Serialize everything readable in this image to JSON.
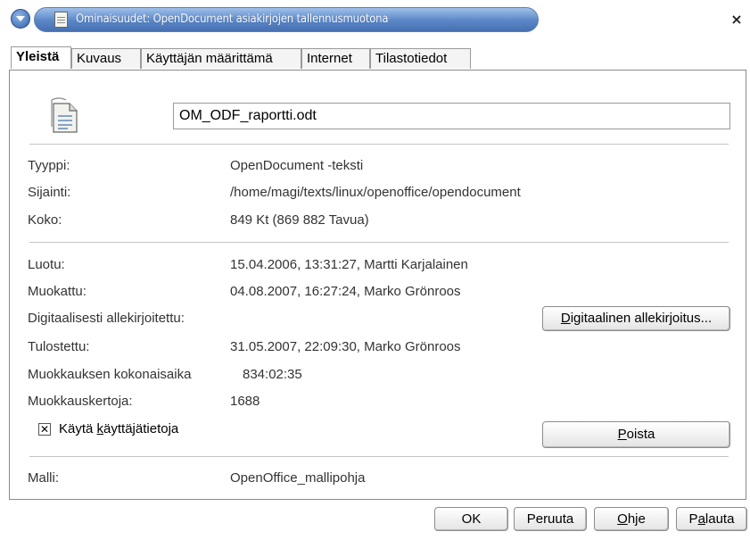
{
  "window": {
    "title": "Ominaisuudet: OpenDocument asiakirjojen tallennusmuotona",
    "close_glyph": "×"
  },
  "tabs": [
    {
      "label": "Yleistä",
      "active": true
    },
    {
      "label": "Kuvaus",
      "active": false
    },
    {
      "label": "Käyttäjän määrittämä",
      "active": false
    },
    {
      "label": "Internet",
      "active": false
    },
    {
      "label": "Tilastotiedot",
      "active": false
    }
  ],
  "general": {
    "file_icon": "document-icon",
    "file_name": "OM_ODF_raportti.odt",
    "type_label": "Tyyppi:",
    "type_value": "OpenDocument -teksti",
    "location_label": "Sijainti:",
    "location_value": "/home/magi/texts/linux/openoffice/opendocument",
    "size_label": "Koko:",
    "size_value": "849 Kt (869 882 Tavua)",
    "created_label": "Luotu:",
    "created_value": "15.04.2006, 13:31:27, Martti Karjalainen",
    "modified_label": "Muokattu:",
    "modified_value": "04.08.2007, 16:27:24, Marko Grönroos",
    "signed_label": "Digitaalisesti allekirjoitettu:",
    "signature_button_mnemonic": "D",
    "signature_button_rest": "igitaalinen allekirjoitus...",
    "printed_label": "Tulostettu:",
    "printed_value": "31.05.2007, 22:09:30, Marko Grönroos",
    "edit_time_label": "Muokkauksen kokonaisaika",
    "edit_time_value": "834:02:35",
    "revision_label": "Muokkauskertoja:",
    "revision_value": "1688",
    "use_user_data_checked": true,
    "use_user_data_check_glyph": "✕",
    "use_user_data_pre": "Käytä ",
    "use_user_data_mnemonic": "k",
    "use_user_data_post": "äyttäjätietoja",
    "delete_button_mnemonic": "P",
    "delete_button_rest": "oista",
    "template_label": "Malli:",
    "template_value": "OpenOffice_mallipohja"
  },
  "buttons": {
    "ok": "OK",
    "cancel": "Peruuta",
    "help_mnemonic": "O",
    "help_rest": "hje",
    "reset_pre": "P",
    "reset_mnemonic": "a",
    "reset_rest": "lauta"
  },
  "colors": {
    "title_bar_blue": "#5a86c6",
    "border_gray": "#8a8a8a"
  }
}
